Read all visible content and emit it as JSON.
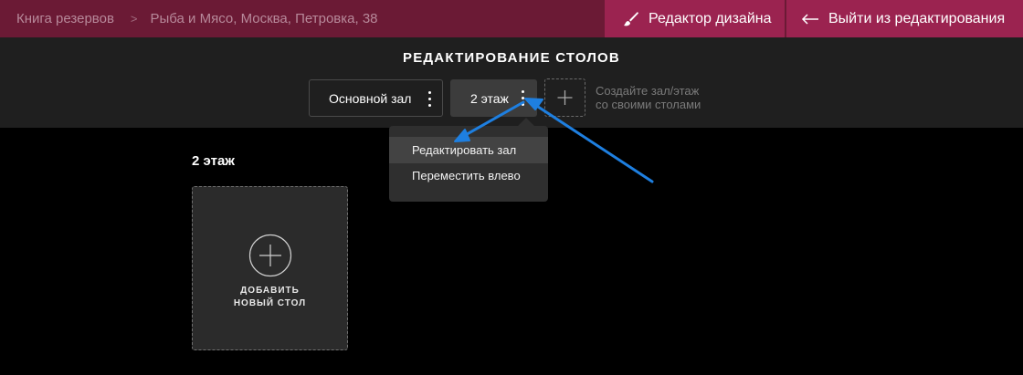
{
  "topbar": {
    "breadcrumb": [
      "Книга резервов",
      "Рыба и Мясо, Москва, Петровка, 38"
    ],
    "separator": ">",
    "designer_button": "Редактор дизайна",
    "exit_button": "Выйти из редактирования",
    "icons": {
      "designer": "brush-icon",
      "exit": "arrow-left-icon"
    }
  },
  "editor": {
    "title": "РЕДАКТИРОВАНИЕ СТОЛОВ",
    "tabs": [
      {
        "label": "Основной зал",
        "active": false
      },
      {
        "label": "2 этаж",
        "active": true
      }
    ],
    "hint_line1": "Создайте зал/этаж",
    "hint_line2": "со своими столами"
  },
  "dropdown": {
    "items": [
      "Редактировать зал",
      "Переместить влево"
    ],
    "highlighted_index": 0
  },
  "floor": {
    "title": "2 этаж",
    "add_table_line1": "ДОБАВИТЬ",
    "add_table_line2": "НОВЫЙ СТОЛ"
  },
  "colors": {
    "topbar": "#6b1a35",
    "accent": "#9b2350",
    "annotation_arrow": "#1e7fe0"
  }
}
